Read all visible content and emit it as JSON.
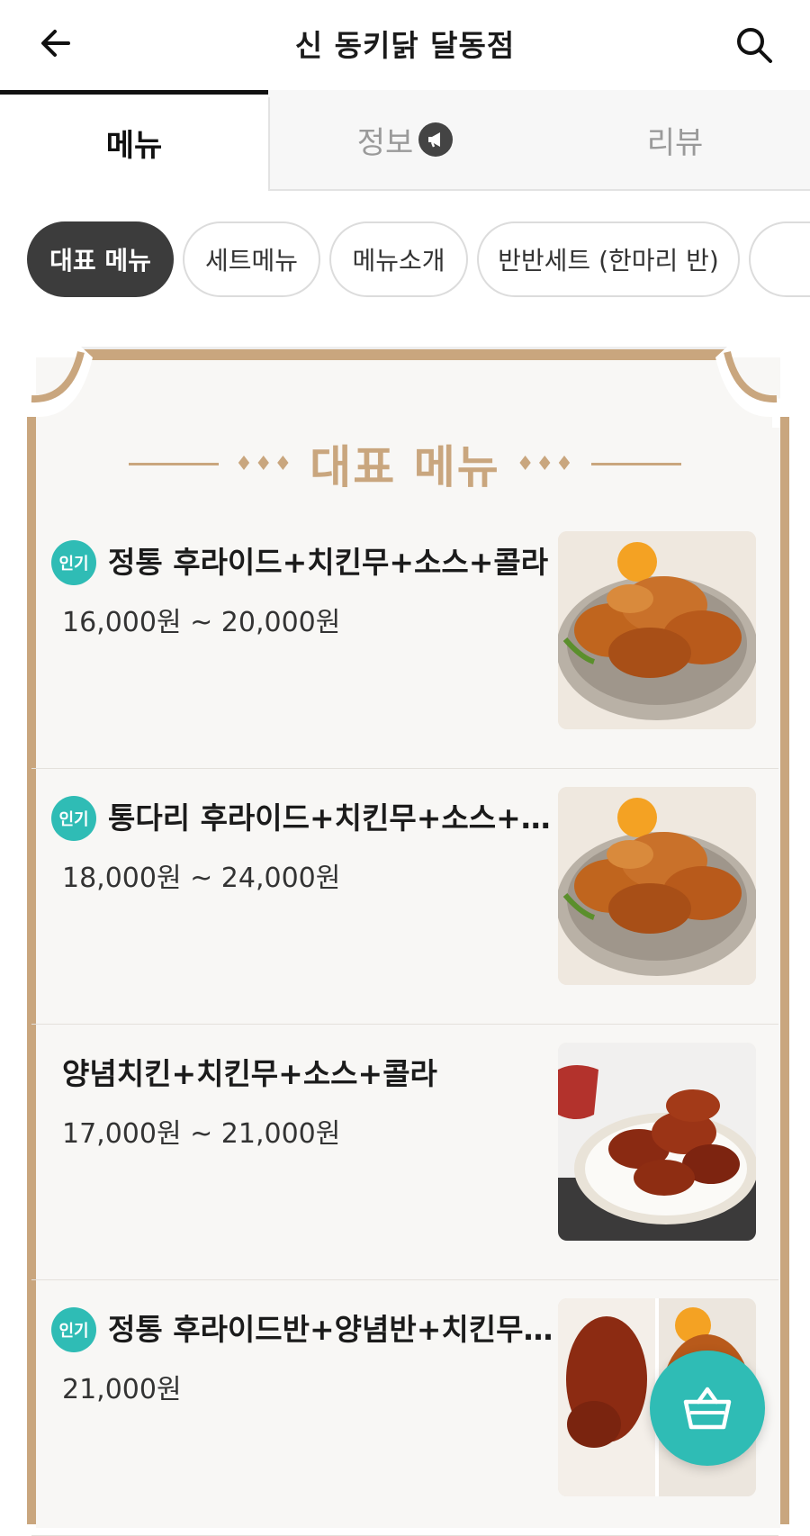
{
  "header": {
    "title": "신 동키닭 달동점",
    "back_icon": "arrow-left-icon",
    "search_icon": "search-icon"
  },
  "tabs": [
    {
      "label": "메뉴",
      "active": true
    },
    {
      "label": "정보",
      "icon": "megaphone-icon"
    },
    {
      "label": "리뷰"
    }
  ],
  "chips": [
    {
      "label": "대표 메뉴",
      "active": true
    },
    {
      "label": "세트메뉴"
    },
    {
      "label": "메뉴소개"
    },
    {
      "label": "반반세트 (한마리 반)"
    }
  ],
  "section": {
    "title": "대표 메뉴",
    "ornament": "♦♦♦"
  },
  "badge_label": "인기",
  "items": [
    {
      "name": "정통 후라이드+치킨무+소스+콜라",
      "price": "16,000원 ~ 20,000원",
      "badge": true
    },
    {
      "name": "통다리 후라이드+치킨무+소스+콜라",
      "price": "18,000원 ~ 24,000원",
      "badge": true
    },
    {
      "name": "양념치킨+치킨무+소스+콜라",
      "price": "17,000원 ~ 21,000원",
      "badge": false
    },
    {
      "name": "정통 후라이드반+양념반+치킨무+소스+콜라",
      "price": "21,000원",
      "badge": true
    }
  ],
  "cart": {
    "icon": "shopping-basket-icon"
  },
  "colors": {
    "accent": "#2fbcb5",
    "gold": "#c9a67e",
    "chip_active": "#3c3c3c"
  }
}
